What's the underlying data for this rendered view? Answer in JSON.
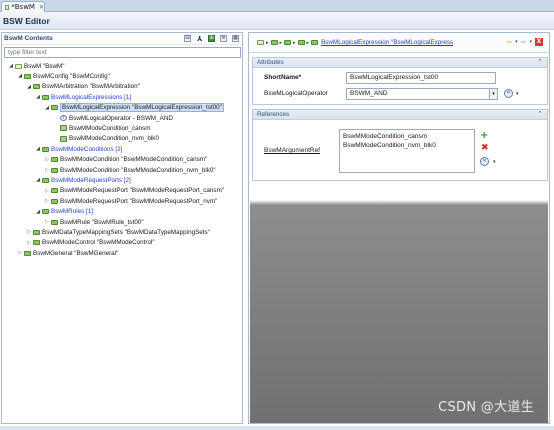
{
  "editor_tab": {
    "label": "*BswM",
    "close": "✕"
  },
  "header": {
    "title": "BSW Editor"
  },
  "left_panel": {
    "title": "BswM Contents",
    "filter_placeholder": "type filter text",
    "tools": [
      "⊟",
      "⅄",
      "⊞",
      "≡",
      "▦"
    ]
  },
  "tree": [
    {
      "arrow": "◢",
      "icon": "folder-root",
      "label": "BswM \"BswM\"",
      "blue": false,
      "level": 0
    },
    {
      "arrow": "◢",
      "icon": "folder",
      "label": "BswMConfig \"BswMConfig\"",
      "blue": false,
      "level": 1
    },
    {
      "arrow": "◢",
      "icon": "folder",
      "label": "BswMArbitration \"BswMArbitration\"",
      "blue": false,
      "level": 2
    },
    {
      "arrow": "◢",
      "icon": "folder",
      "label": "BswMLogicalExpressions [1]",
      "blue": true,
      "level": 3
    },
    {
      "arrow": "◢",
      "icon": "folder",
      "label": "BswMLogicalExpression \"BswMLogicalExpression_tst00\"",
      "blue": false,
      "level": 4,
      "selected": true
    },
    {
      "arrow": "",
      "icon": "t",
      "label": "BswMLogicalOperator - BSWM_AND",
      "blue": false,
      "level": 5
    },
    {
      "arrow": "",
      "icon": "ref",
      "label": "BswMModeCondition_cansm",
      "blue": false,
      "level": 5
    },
    {
      "arrow": "",
      "icon": "ref",
      "label": "BswMModeCondition_nvm_blk0",
      "blue": false,
      "level": 5
    },
    {
      "arrow": "◢",
      "icon": "folder",
      "label": "BswMModeConditions [2]",
      "blue": true,
      "level": 3
    },
    {
      "arrow": "▷",
      "icon": "folder",
      "label": "BswMModeCondition \"BswMModeCondition_cansm\"",
      "blue": false,
      "level": 4
    },
    {
      "arrow": "▷",
      "icon": "folder",
      "label": "BswMModeCondition \"BswMModeCondition_nvm_blk0\"",
      "blue": false,
      "level": 4
    },
    {
      "arrow": "◢",
      "icon": "folder",
      "label": "BswMModeRequestPorts [2]",
      "blue": true,
      "level": 3
    },
    {
      "arrow": "▷",
      "icon": "folder",
      "label": "BswMModeRequestPort \"BswMModeRequestPort_cansm\"",
      "blue": false,
      "level": 4
    },
    {
      "arrow": "▷",
      "icon": "folder",
      "label": "BswMModeRequestPort \"BswMModeRequestPort_nvm\"",
      "blue": false,
      "level": 4
    },
    {
      "arrow": "◢",
      "icon": "folder",
      "label": "BswMRules [1]",
      "blue": true,
      "level": 3
    },
    {
      "arrow": "▷",
      "icon": "folder",
      "label": "BswMRule \"BswMRule_tst00\"",
      "blue": false,
      "level": 4
    },
    {
      "arrow": "▷",
      "icon": "folder",
      "label": "BswMDataTypeMappingSets \"BswMDataTypeMappingSets\"",
      "blue": false,
      "level": 2
    },
    {
      "arrow": "▷",
      "icon": "folder",
      "label": "BswMModeControl \"BswMModeControl\"",
      "blue": false,
      "level": 2
    },
    {
      "arrow": "▷",
      "icon": "folder",
      "label": "BswMGeneral \"BswMGeneral\"",
      "blue": false,
      "level": 1
    }
  ],
  "breadcrumb": {
    "link": "BswMLogicalExpression \"BswMLogicalExpress",
    "sep": "▸"
  },
  "nav": {
    "back": "⇦",
    "forward": "⇨",
    "menu": "▾",
    "close": "X"
  },
  "attributes": {
    "title": "Attributes",
    "collapse": "⌃",
    "shortname_label": "ShortName*",
    "shortname_value": "BswMLogicalExpression_tst00",
    "operator_label": "BswMLogicalOperator",
    "operator_value": "BSWM_AND"
  },
  "references": {
    "title": "References",
    "collapse": "⌃",
    "argument_label": "BswMArgumentRef",
    "items": [
      "BswMModeCondition_cansm",
      "BswMModeCondition_nvm_blk0"
    ]
  },
  "misc": {
    "circle_glyph": "✕",
    "caret": "▾",
    "add": "+",
    "del": "✖"
  },
  "watermark": "CSDN @大道生"
}
